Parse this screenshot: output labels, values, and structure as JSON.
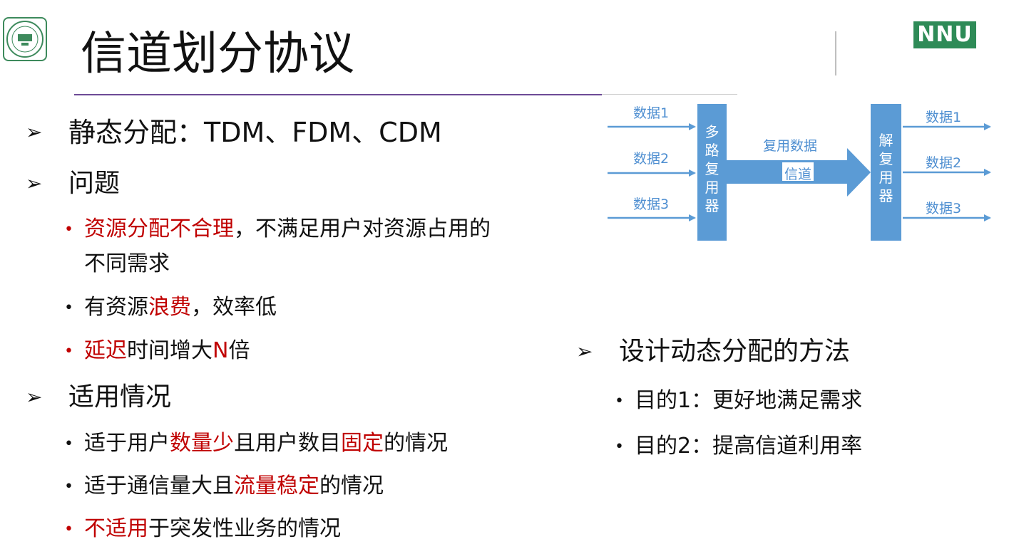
{
  "title": "信道划分协议",
  "logo": {
    "right_text": "NNU"
  },
  "colors": {
    "accent_purple": "#6d4a96",
    "red": "#c00000",
    "blue": "#5b9bd5",
    "green": "#2e8b57"
  },
  "left": {
    "static_alloc": "静态分配：TDM、FDM、CDM",
    "problem": {
      "heading": "问题",
      "item1_red": "资源分配不合理",
      "item1_rest_a": "，不满足用户对资源占用的",
      "item1_rest_b": "不同需求",
      "item2_a": "有资源",
      "item2_red": "浪费",
      "item2_b": "，效率低",
      "item3_red": "延迟",
      "item3_a": "时间增大",
      "item3_red2": "N",
      "item3_b": "倍"
    },
    "applicable": {
      "heading": "适用情况",
      "item1_a": "适于用户",
      "item1_red": "数量少",
      "item1_b": "且用户数目",
      "item1_red2": "固定",
      "item1_c": "的情况",
      "item2_a": "适于通信量大且",
      "item2_red": "流量稳定",
      "item2_b": "的情况",
      "item3_red": "不适用",
      "item3_a": "于突发性业务的情况"
    }
  },
  "right": {
    "heading": "设计动态分配的方法",
    "goal1": "目的1：更好地满足需求",
    "goal2": "目的2：提高信道利用率"
  },
  "diagram": {
    "inputs": [
      "数据1",
      "数据2",
      "数据3"
    ],
    "outputs": [
      "数据1",
      "数据2",
      "数据3"
    ],
    "mux_chars": [
      "多",
      "路",
      "复",
      "用",
      "器"
    ],
    "demux_chars": [
      "解",
      "复",
      "用",
      "器"
    ],
    "channel_top": "复用数据",
    "channel_mid": "信道"
  }
}
